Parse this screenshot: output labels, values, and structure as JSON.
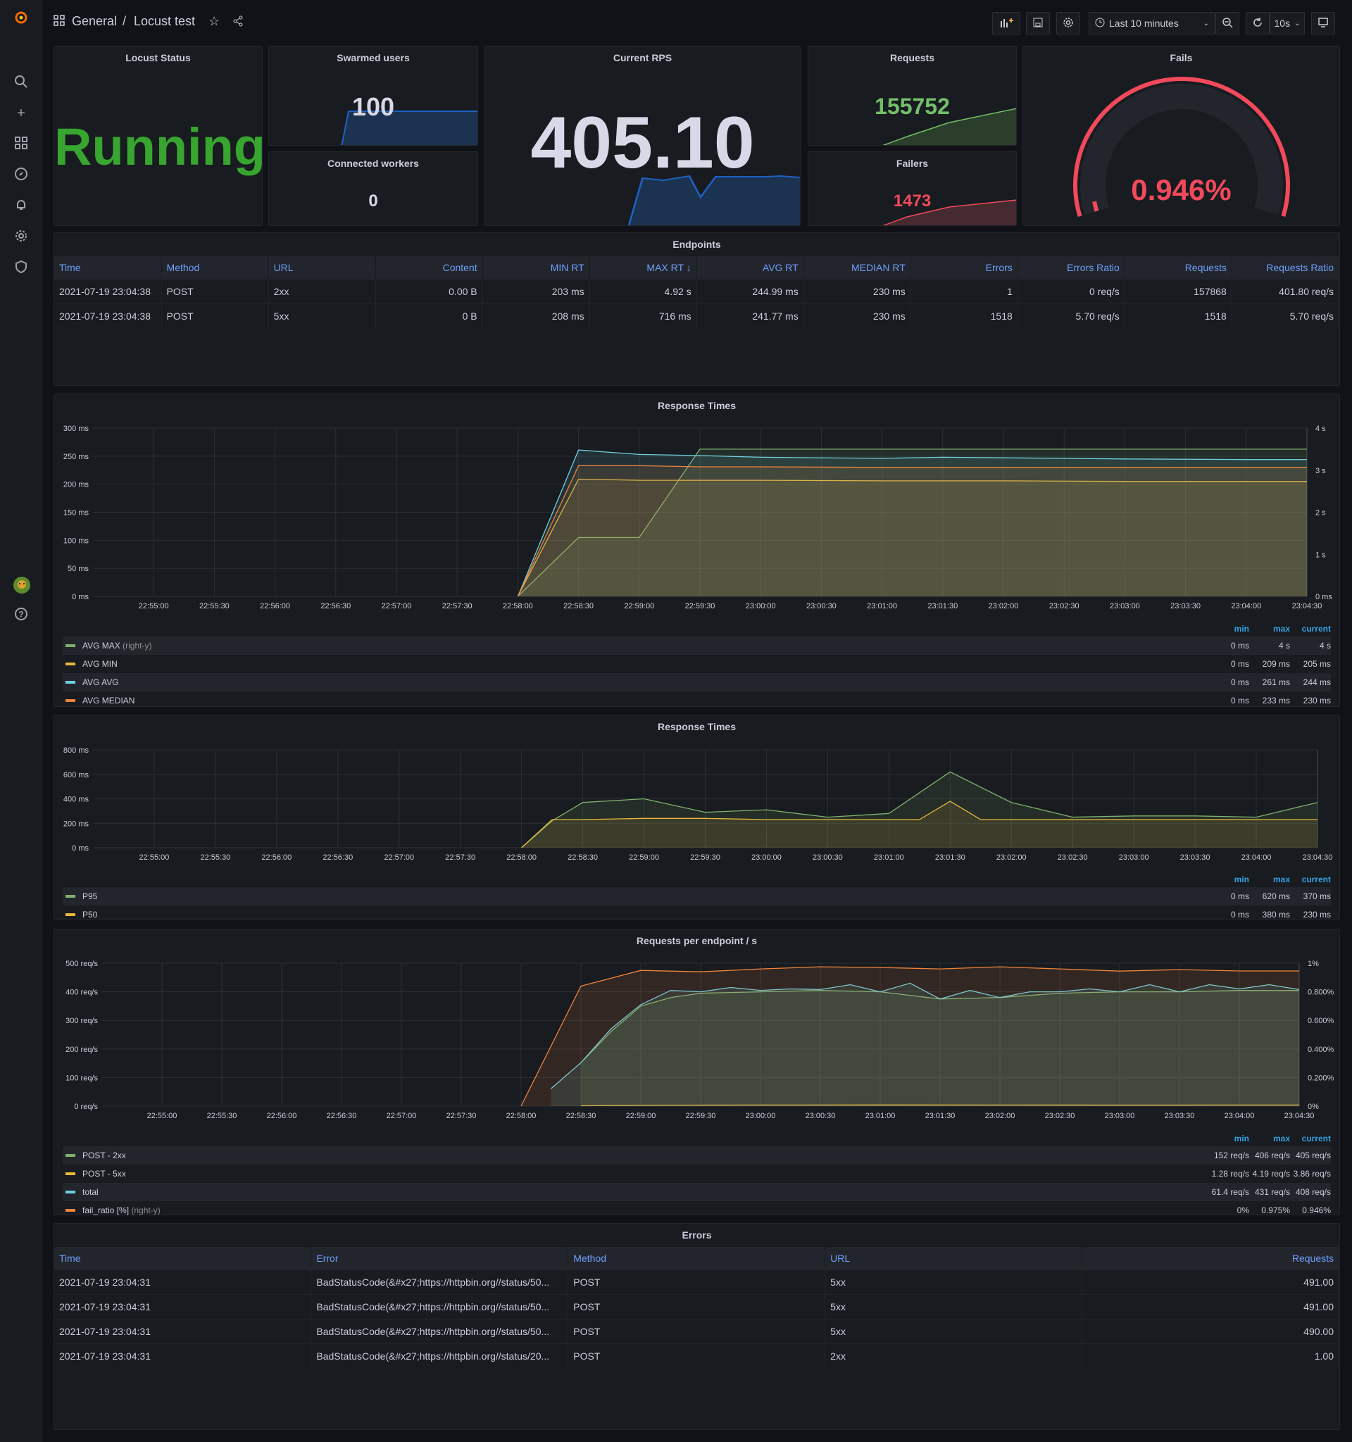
{
  "header": {
    "folder": "General",
    "separator": "/",
    "title": "Locust test",
    "time_range": "Last 10 minutes",
    "refresh_interval": "10s"
  },
  "sidebar": {
    "icons": [
      "grafana-logo-icon",
      "search-icon",
      "plus-icon",
      "dashboards-icon",
      "explore-icon",
      "alert-bell-icon",
      "gear-icon",
      "shield-icon",
      "user-avatar-icon",
      "help-icon"
    ]
  },
  "colors": {
    "green": "#7EB26D",
    "yellow": "#EAB839",
    "cyan": "#6ED0E0",
    "orange": "#EF843C",
    "red": "#F2495C",
    "blue": "#1F60C4",
    "stat_green": "#37A52F",
    "link_blue": "#6e9fff"
  },
  "stats": {
    "locust_status": {
      "title": "Locust Status",
      "value": "Running"
    },
    "swarmed_users": {
      "title": "Swarmed users",
      "value": "100"
    },
    "connected_workers": {
      "title": "Connected workers",
      "value": "0"
    },
    "current_rps": {
      "title": "Current RPS",
      "value": "405.10"
    },
    "requests": {
      "title": "Requests",
      "value": "155752"
    },
    "failers": {
      "title": "Failers",
      "value": "1473"
    },
    "fails": {
      "title": "Fails",
      "value": "0.946%",
      "gauge_fraction": 0.00946
    }
  },
  "endpoints": {
    "title": "Endpoints",
    "columns": [
      "Time",
      "Method",
      "URL",
      "Content",
      "MIN RT",
      "MAX RT ↓",
      "AVG RT",
      "MEDIAN RT",
      "Errors",
      "Errors Ratio",
      "Requests",
      "Requests Ratio"
    ],
    "rows": [
      [
        "2021-07-19 23:04:38",
        "POST",
        "2xx",
        "0.00 B",
        "203 ms",
        "4.92 s",
        "244.99 ms",
        "230 ms",
        "1",
        "0 req/s",
        "157868",
        "401.80 req/s"
      ],
      [
        "2021-07-19 23:04:38",
        "POST",
        "5xx",
        "0 B",
        "208 ms",
        "716 ms",
        "241.77 ms",
        "230 ms",
        "1518",
        "5.70 req/s",
        "1518",
        "5.70 req/s"
      ]
    ]
  },
  "errors": {
    "title": "Errors",
    "columns": [
      "Time",
      "Error",
      "Method",
      "URL",
      "Requests"
    ],
    "rows": [
      [
        "2021-07-19 23:04:31",
        "BadStatusCode(&#x27;https://httpbin.org//status/50...",
        "POST",
        "5xx",
        "491.00"
      ],
      [
        "2021-07-19 23:04:31",
        "BadStatusCode(&#x27;https://httpbin.org//status/50...",
        "POST",
        "5xx",
        "491.00"
      ],
      [
        "2021-07-19 23:04:31",
        "BadStatusCode(&#x27;https://httpbin.org//status/50...",
        "POST",
        "5xx",
        "490.00"
      ],
      [
        "2021-07-19 23:04:31",
        "BadStatusCode(&#x27;https://httpbin.org//status/20...",
        "POST",
        "2xx",
        "1.00"
      ]
    ]
  },
  "chart_data": [
    {
      "type": "area",
      "title": "Response Times",
      "xlim": [
        "22:54:30",
        "23:04:30"
      ],
      "xticks": [
        "22:55:00",
        "22:55:30",
        "22:56:00",
        "22:56:30",
        "22:57:00",
        "22:57:30",
        "22:58:00",
        "22:58:30",
        "22:59:00",
        "22:59:30",
        "23:00:00",
        "23:00:30",
        "23:01:00",
        "23:01:30",
        "23:02:00",
        "23:02:30",
        "23:03:00",
        "23:03:30",
        "23:04:00",
        "23:04:30"
      ],
      "ylim": [
        0,
        300
      ],
      "yticks": [
        "0 ms",
        "50 ms",
        "100 ms",
        "150 ms",
        "200 ms",
        "250 ms",
        "300 ms"
      ],
      "y2lim": [
        0,
        4
      ],
      "y2ticks": [
        "0 ms",
        "1 s",
        "2 s",
        "3 s",
        "4 s"
      ],
      "grid": true,
      "legend_headers": [
        "min",
        "max",
        "current"
      ],
      "series": [
        {
          "name": "AVG MAX",
          "suffix": "(right-y)",
          "axis": "right",
          "color": "#7EB26D",
          "x": [
            "22:58:00",
            "22:58:30",
            "22:59:00",
            "22:59:30",
            "23:00:00",
            "23:01:00",
            "23:02:00",
            "23:03:00",
            "23:04:00",
            "23:04:30"
          ],
          "values": [
            0,
            1.4,
            1.4,
            3.5,
            3.5,
            3.5,
            3.5,
            3.5,
            3.5,
            3.5
          ],
          "stats": [
            "0 ms",
            "4 s",
            "4 s"
          ]
        },
        {
          "name": "AVG MIN",
          "axis": "left",
          "color": "#EAB839",
          "x": [
            "22:58:00",
            "22:58:30",
            "22:59:00",
            "22:59:30",
            "23:00:00",
            "23:01:00",
            "23:02:00",
            "23:03:00",
            "23:04:00",
            "23:04:30"
          ],
          "values": [
            0,
            209,
            207,
            207,
            207,
            206,
            206,
            205,
            205,
            205
          ],
          "stats": [
            "0 ms",
            "209 ms",
            "205 ms"
          ]
        },
        {
          "name": "AVG AVG",
          "axis": "left",
          "color": "#6ED0E0",
          "x": [
            "22:58:00",
            "22:58:30",
            "22:59:00",
            "22:59:30",
            "23:00:00",
            "23:01:00",
            "23:01:30",
            "23:02:00",
            "23:03:00",
            "23:04:00",
            "23:04:30"
          ],
          "values": [
            0,
            261,
            253,
            251,
            248,
            246,
            248,
            247,
            245,
            244,
            244
          ],
          "stats": [
            "0 ms",
            "261 ms",
            "244 ms"
          ]
        },
        {
          "name": "AVG MEDIAN",
          "axis": "left",
          "color": "#EF843C",
          "x": [
            "22:58:00",
            "22:58:30",
            "22:59:00",
            "22:59:30",
            "23:00:00",
            "23:01:00",
            "23:02:00",
            "23:03:00",
            "23:04:00",
            "23:04:30"
          ],
          "values": [
            0,
            233,
            233,
            231,
            231,
            230,
            230,
            230,
            230,
            230
          ],
          "stats": [
            "0 ms",
            "233 ms",
            "230 ms"
          ]
        }
      ]
    },
    {
      "type": "area",
      "title": "Response Times",
      "xlim": [
        "22:54:30",
        "23:04:30"
      ],
      "xticks": [
        "22:55:00",
        "22:55:30",
        "22:56:00",
        "22:56:30",
        "22:57:00",
        "22:57:30",
        "22:58:00",
        "22:58:30",
        "22:59:00",
        "22:59:30",
        "23:00:00",
        "23:00:30",
        "23:01:00",
        "23:01:30",
        "23:02:00",
        "23:02:30",
        "23:03:00",
        "23:03:30",
        "23:04:00",
        "23:04:30"
      ],
      "ylim": [
        0,
        800
      ],
      "yticks": [
        "0 ms",
        "200 ms",
        "400 ms",
        "600 ms",
        "800 ms"
      ],
      "grid": true,
      "legend_headers": [
        "min",
        "max",
        "current"
      ],
      "series": [
        {
          "name": "P95",
          "axis": "left",
          "color": "#7EB26D",
          "x": [
            "22:58:00",
            "22:58:15",
            "22:58:30",
            "22:59:00",
            "22:59:30",
            "23:00:00",
            "23:00:30",
            "23:01:00",
            "23:01:30",
            "23:02:00",
            "23:02:30",
            "23:03:00",
            "23:03:30",
            "23:04:00",
            "23:04:30"
          ],
          "values": [
            0,
            220,
            370,
            400,
            290,
            310,
            250,
            280,
            620,
            370,
            250,
            260,
            260,
            250,
            370
          ],
          "stats": [
            "0 ms",
            "620 ms",
            "370 ms"
          ]
        },
        {
          "name": "P50",
          "axis": "left",
          "color": "#EAB839",
          "x": [
            "22:58:00",
            "22:58:15",
            "22:58:30",
            "22:59:00",
            "22:59:30",
            "23:00:00",
            "23:00:30",
            "23:01:00",
            "23:01:15",
            "23:01:30",
            "23:01:45",
            "23:02:00",
            "23:03:00",
            "23:04:00",
            "23:04:30"
          ],
          "values": [
            0,
            230,
            230,
            240,
            240,
            230,
            230,
            230,
            230,
            380,
            230,
            230,
            230,
            230,
            230
          ],
          "stats": [
            "0 ms",
            "380 ms",
            "230 ms"
          ]
        }
      ]
    },
    {
      "type": "area",
      "title": "Requests per endpoint / s",
      "xlim": [
        "22:54:30",
        "23:04:30"
      ],
      "xticks": [
        "22:55:00",
        "22:55:30",
        "22:56:00",
        "22:56:30",
        "22:57:00",
        "22:57:30",
        "22:58:00",
        "22:58:30",
        "22:59:00",
        "22:59:30",
        "23:00:00",
        "23:00:30",
        "23:01:00",
        "23:01:30",
        "23:02:00",
        "23:02:30",
        "23:03:00",
        "23:03:30",
        "23:04:00",
        "23:04:30"
      ],
      "ylim": [
        0,
        500
      ],
      "yticks": [
        "0 req/s",
        "100 req/s",
        "200 req/s",
        "300 req/s",
        "400 req/s",
        "500 req/s"
      ],
      "y2lim": [
        0,
        1
      ],
      "y2ticks": [
        "0%",
        "0.200%",
        "0.400%",
        "0.600%",
        "0.800%",
        "1%"
      ],
      "grid": true,
      "legend_headers": [
        "min",
        "max",
        "current"
      ],
      "series": [
        {
          "name": "POST - 2xx",
          "axis": "left",
          "color": "#7EB26D",
          "x": [
            "22:58:30",
            "22:58:45",
            "22:59:00",
            "22:59:15",
            "22:59:30",
            "23:00:00",
            "23:00:30",
            "23:01:00",
            "23:01:30",
            "23:02:00",
            "23:02:30",
            "23:03:00",
            "23:03:30",
            "23:04:00",
            "23:04:30"
          ],
          "values": [
            152,
            260,
            350,
            380,
            395,
            400,
            405,
            400,
            375,
            380,
            395,
            400,
            400,
            405,
            405
          ],
          "stats": [
            "152 req/s",
            "406 req/s",
            "405 req/s"
          ]
        },
        {
          "name": "POST - 5xx",
          "axis": "left",
          "color": "#EAB839",
          "x": [
            "22:58:30",
            "22:59:00",
            "23:00:00",
            "23:01:00",
            "23:02:00",
            "23:03:00",
            "23:04:00",
            "23:04:30"
          ],
          "values": [
            1.28,
            3.5,
            4.0,
            4.19,
            3.9,
            3.8,
            3.9,
            3.86
          ],
          "stats": [
            "1.28 req/s",
            "4.19 req/s",
            "3.86 req/s"
          ]
        },
        {
          "name": "total",
          "axis": "left",
          "color": "#6ED0E0",
          "x": [
            "22:58:15",
            "22:58:30",
            "22:58:45",
            "22:59:00",
            "22:59:15",
            "22:59:30",
            "22:59:45",
            "23:00:00",
            "23:00:15",
            "23:00:30",
            "23:00:45",
            "23:01:00",
            "23:01:15",
            "23:01:30",
            "23:01:45",
            "23:02:00",
            "23:02:15",
            "23:02:30",
            "23:02:45",
            "23:03:00",
            "23:03:15",
            "23:03:30",
            "23:03:45",
            "23:04:00",
            "23:04:15",
            "23:04:30"
          ],
          "values": [
            61.4,
            152,
            270,
            355,
            405,
            400,
            415,
            405,
            410,
            408,
            425,
            400,
            430,
            375,
            405,
            380,
            400,
            400,
            410,
            400,
            425,
            400,
            425,
            410,
            425,
            408
          ],
          "stats": [
            "61.4 req/s",
            "431 req/s",
            "408 req/s"
          ]
        },
        {
          "name": "fail_ratio [%]",
          "suffix": "(right-y)",
          "axis": "right",
          "color": "#EF843C",
          "x": [
            "22:58:00",
            "22:58:30",
            "22:59:00",
            "22:59:30",
            "23:00:00",
            "23:00:30",
            "23:01:00",
            "23:01:30",
            "23:02:00",
            "23:02:30",
            "23:03:00",
            "23:03:30",
            "23:04:00",
            "23:04:30"
          ],
          "values": [
            0,
            0.84,
            0.95,
            0.94,
            0.96,
            0.975,
            0.97,
            0.96,
            0.975,
            0.96,
            0.945,
            0.955,
            0.946,
            0.946
          ],
          "stats": [
            "0%",
            "0.975%",
            "0.946%"
          ]
        }
      ]
    }
  ]
}
